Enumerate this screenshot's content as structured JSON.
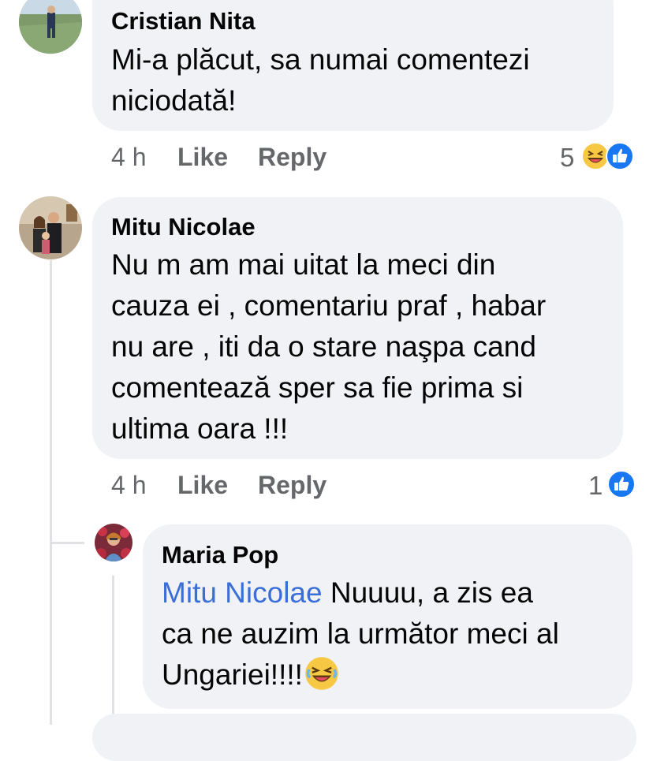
{
  "comments": [
    {
      "author": "Cristian Nita",
      "text_lines": [
        "Mi-a plăcut, sa numai comentezi",
        "niciodată!"
      ],
      "time": "4 h",
      "like_label": "Like",
      "reply_label": "Reply",
      "reaction_count": "5",
      "reactions": [
        "laugh-emoji-icon",
        "like-icon"
      ]
    },
    {
      "author": "Mitu Nicolae",
      "text_lines": [
        "Nu m am mai uitat la meci din",
        "cauza ei , comentariu praf , habar",
        "nu are , iti da o stare naşpa cand",
        "comentează sper sa fie prima si",
        "ultima oara !!!"
      ],
      "time": "4 h",
      "like_label": "Like",
      "reply_label": "Reply",
      "reaction_count": "1",
      "reactions": [
        "like-icon"
      ]
    }
  ],
  "reply": {
    "author": "Maria Pop",
    "mention": "Mitu Nicolae",
    "text_line1_rest": " Nuuuu, a zis ea",
    "text_line2": "ca ne auzim la următor meci al",
    "text_line3": "Ungariei!!!!",
    "emoji": "laugh-emoji-icon"
  },
  "colors": {
    "bubble": "#f0f2f5",
    "meta": "#65676b",
    "mention": "#3b6fd8",
    "like_blue": "#1877f2",
    "laugh_yellow": "#f7c844"
  }
}
